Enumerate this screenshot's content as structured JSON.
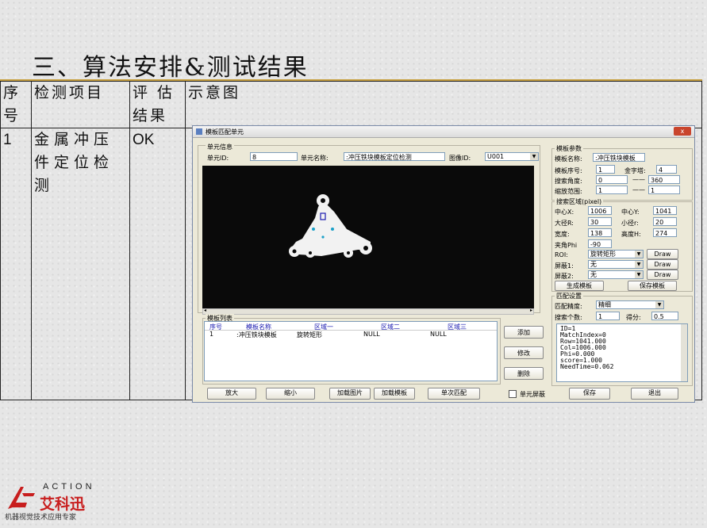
{
  "slide": {
    "title": "三、算法安排&测试结果",
    "table": {
      "headers": [
        "序号",
        "检测项目",
        "评 估结果",
        "示意图"
      ],
      "rows": [
        {
          "no": "1",
          "item": "金属冲压件定位检测",
          "result": "OK"
        }
      ]
    },
    "logo": {
      "action": "ACTION",
      "brand": "艾科迅",
      "tagline": "机器视觉技术应用专家"
    }
  },
  "app": {
    "window_title": "模板匹配单元",
    "close": "x",
    "unit_info": {
      "group": "单元信息",
      "id_label": "单元ID:",
      "id_value": "8",
      "name_label": "单元名称:",
      "name_value": ":冲压铁块模板定位检测",
      "image_label": "图像ID:",
      "image_value": "U001"
    },
    "template_params": {
      "group": "模板参数",
      "name_label": "模板名称:",
      "name_value": ":冲压铁块模板",
      "seq_label": "模板序号:",
      "seq_value": "1",
      "pyramid_label": "金字塔:",
      "pyramid_value": "4",
      "angle_label": "搜索角度:",
      "angle_min": "0",
      "angle_max": "360",
      "scale_label": "缩放范围:",
      "scale_min": "1",
      "scale_max": "1",
      "dash": "——"
    },
    "search_region": {
      "group": "搜索区域(pixel)",
      "cx_label": "中心X:",
      "cx": "1006",
      "cy_label": "中心Y:",
      "cy": "1041",
      "major_label": "大径R:",
      "major": "30",
      "minor_label": "小径r:",
      "minor": "20",
      "width_label": "宽度:",
      "width": "138",
      "height_label": "高度H:",
      "height": "274",
      "phi_label": "夹角Phi",
      "phi": "-90",
      "roi_label": "ROI:",
      "roi_value": "旋转矩形",
      "mask1_label": "屏蔽1:",
      "mask1_value": "无",
      "mask2_label": "屏蔽2:",
      "mask2_value": "无",
      "draw": "Draw",
      "gen_button": "生成模板",
      "save_template_button": "保存模板"
    },
    "match_settings": {
      "group": "匹配设置",
      "precision_label": "匹配精度:",
      "precision_value": "精细",
      "count_label": "搜索个数:",
      "count_value": "1",
      "score_label": "得分:",
      "score_value": "0.5"
    },
    "result_lines": [
      "ID=1",
      "MatchIndex=0",
      "Row=1041.000",
      "Col=1006.000",
      "Phi=0.000",
      "score=1.000",
      "NeedTime=0.062"
    ],
    "template_list": {
      "group": "模板列表",
      "headers": [
        "序号",
        "模板名称",
        "区域一",
        "区域二",
        "区域三"
      ],
      "rows": [
        [
          "1",
          ":冲压铁块模板",
          "旋转矩形",
          "NULL",
          "NULL"
        ]
      ]
    },
    "side_buttons": {
      "add": "添加",
      "modify": "修改",
      "delete": "删除"
    },
    "bottom_bar": {
      "zoom_in": "放大",
      "zoom_out": "缩小",
      "load_image": "加载图片",
      "load_template": "加载模板",
      "single_match": "单次匹配",
      "unit_mask": "单元屏蔽",
      "save": "保存",
      "exit": "退出"
    },
    "colors": {
      "accent": "#c8a040",
      "window_bg": "#ece9d8",
      "list_header": "#1a1ab0",
      "marker_blue": "#1aa0c8"
    }
  }
}
